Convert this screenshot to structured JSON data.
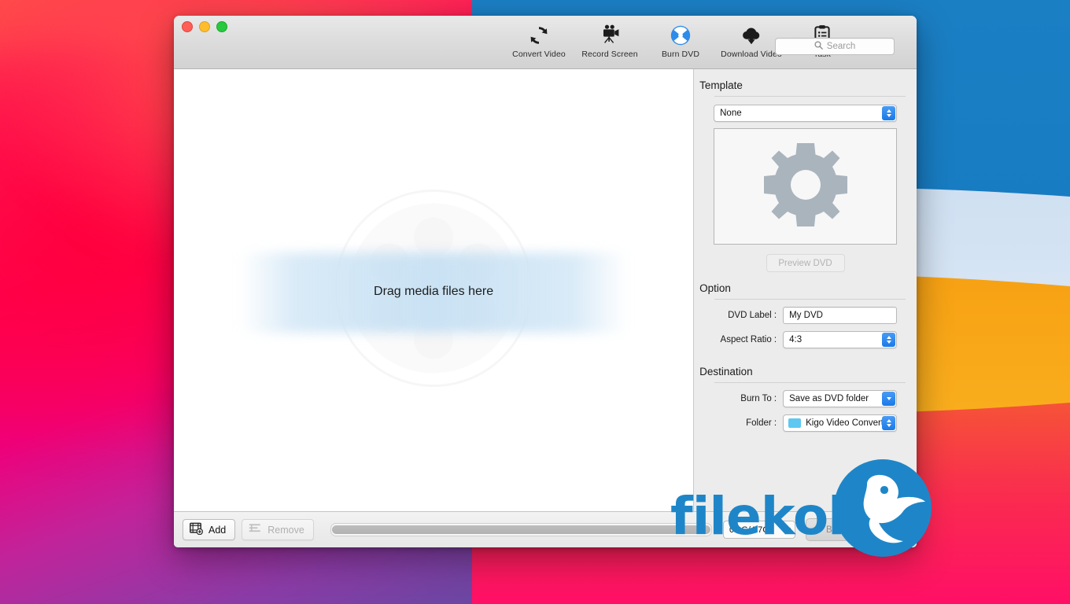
{
  "window": {
    "traffic_lights": [
      {
        "name": "close",
        "color": "#ff5f57"
      },
      {
        "name": "minimize",
        "color": "#ffbd2e"
      },
      {
        "name": "zoom",
        "color": "#28c840"
      }
    ]
  },
  "toolbar": {
    "items": [
      {
        "label": "Convert Video",
        "icon": "convert-refresh-icon"
      },
      {
        "label": "Record Screen",
        "icon": "video-camera-icon"
      },
      {
        "label": "Burn DVD",
        "icon": "burn-disc-icon"
      },
      {
        "label": "Download Video",
        "icon": "cloud-download-icon"
      },
      {
        "label": "Task",
        "icon": "clipboard-list-icon"
      }
    ],
    "active_item": "Burn DVD",
    "search": {
      "placeholder": "Search",
      "value": "",
      "icon": "search-icon"
    }
  },
  "dropzone": {
    "label": "Drag media files here",
    "watermark_icon": "film-reel-icon"
  },
  "sidebar": {
    "template": {
      "title": "Template",
      "select_value": "None",
      "preview_icon": "gear-icon",
      "preview_button_label": "Preview DVD",
      "preview_button_enabled": false
    },
    "option": {
      "title": "Option",
      "fields": [
        {
          "label": "DVD Label :",
          "value": "My DVD",
          "type": "text"
        },
        {
          "label": "Aspect Ratio :",
          "value": "4:3",
          "type": "popup"
        }
      ]
    },
    "destination": {
      "title": "Destination",
      "fields": [
        {
          "label": "Burn To :",
          "value": "Save as DVD folder",
          "type": "popup"
        },
        {
          "label": "Folder :",
          "value": "Kigo Video Converte...",
          "type": "popup-folder",
          "icon": "folder-icon"
        }
      ]
    }
  },
  "bottombar": {
    "add_label": "Add",
    "add_icon": "add-media-icon",
    "remove_label": "Remove",
    "remove_icon": "remove-media-icon",
    "remove_enabled": false,
    "capacity_text": "0.0G/4.7G",
    "capacity_used_percent": 0,
    "burn_button_label": "Burn DVD Now",
    "burn_button_enabled": false
  },
  "watermark": {
    "text": "filekoka",
    "logo_icon": "bird-logo-icon",
    "color": "#1e86c8"
  },
  "colors": {
    "accent_blue": "#1a7ae8",
    "burn_disc_blue": "#2d8bea",
    "folder_blue": "#5ec8f0",
    "window_chrome": "#dcdcdc",
    "sidebar_bg": "#ececec"
  }
}
